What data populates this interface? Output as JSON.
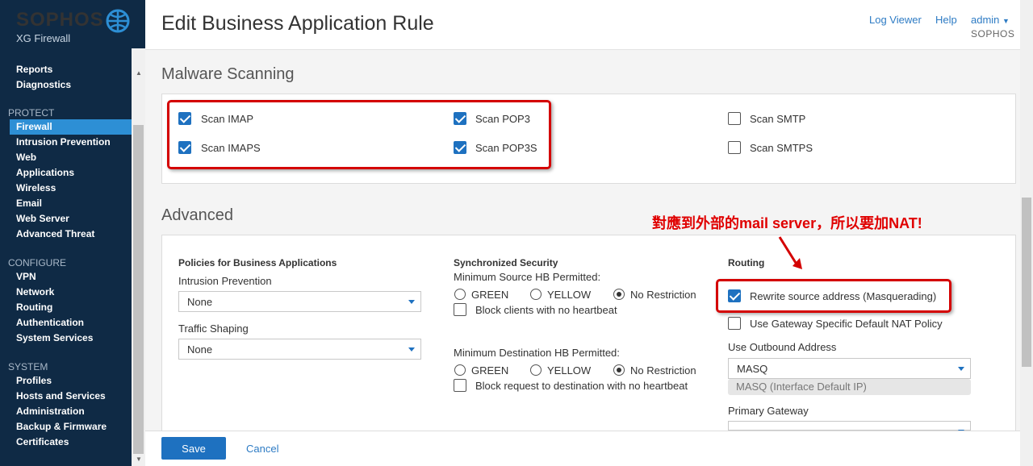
{
  "brand": {
    "name": "SOPHOS",
    "product": "XG Firewall"
  },
  "sidebar": {
    "top_items": [
      "Reports",
      "Diagnostics"
    ],
    "protect": {
      "title": "PROTECT",
      "items": [
        "Firewall",
        "Intrusion Prevention",
        "Web",
        "Applications",
        "Wireless",
        "Email",
        "Web Server",
        "Advanced Threat"
      ]
    },
    "configure": {
      "title": "CONFIGURE",
      "items": [
        "VPN",
        "Network",
        "Routing",
        "Authentication",
        "System Services"
      ]
    },
    "system": {
      "title": "SYSTEM",
      "items": [
        "Profiles",
        "Hosts and Services",
        "Administration",
        "Backup & Firmware",
        "Certificates"
      ]
    }
  },
  "header": {
    "title": "Edit Business Application Rule",
    "log_viewer": "Log Viewer",
    "help": "Help",
    "user": "admin",
    "tenant": "SOPHOS"
  },
  "malware": {
    "title": "Malware Scanning",
    "items": [
      {
        "label": "Scan IMAP",
        "checked": true
      },
      {
        "label": "Scan IMAPS",
        "checked": true
      },
      {
        "label": "Scan POP3",
        "checked": true
      },
      {
        "label": "Scan POP3S",
        "checked": true
      },
      {
        "label": "Scan SMTP",
        "checked": false
      },
      {
        "label": "Scan SMTPS",
        "checked": false
      }
    ]
  },
  "advanced": {
    "title": "Advanced",
    "policies": {
      "heading": "Policies for Business Applications",
      "ips_label": "Intrusion Prevention",
      "ips_value": "None",
      "ts_label": "Traffic Shaping",
      "ts_value": "None"
    },
    "sync": {
      "heading": "Synchronized Security",
      "min_source": "Minimum Source HB Permitted:",
      "min_dest": "Minimum Destination HB Permitted:",
      "opt_green": "GREEN",
      "opt_yellow": "YELLOW",
      "opt_none": "No Restriction",
      "selected": "No Restriction",
      "block_clients": "Block clients with no heartbeat",
      "block_request": "Block request to destination with no heartbeat"
    },
    "routing": {
      "heading": "Routing",
      "rewrite": "Rewrite source address (Masquerading)",
      "rewrite_checked": true,
      "gateway_nat": "Use Gateway Specific Default NAT Policy",
      "gateway_nat_checked": false,
      "outbound_label": "Use Outbound Address",
      "outbound_value": "MASQ",
      "outbound_hint": "MASQ (Interface Default IP)",
      "primary_gw": "Primary Gateway"
    }
  },
  "annotation": "對應到外部的mail server，所以要加NAT!",
  "footer": {
    "save": "Save",
    "cancel": "Cancel"
  },
  "colors": {
    "sidebar": "#0f2a45",
    "accent": "#1e71c0",
    "annotation": "#e00000"
  }
}
